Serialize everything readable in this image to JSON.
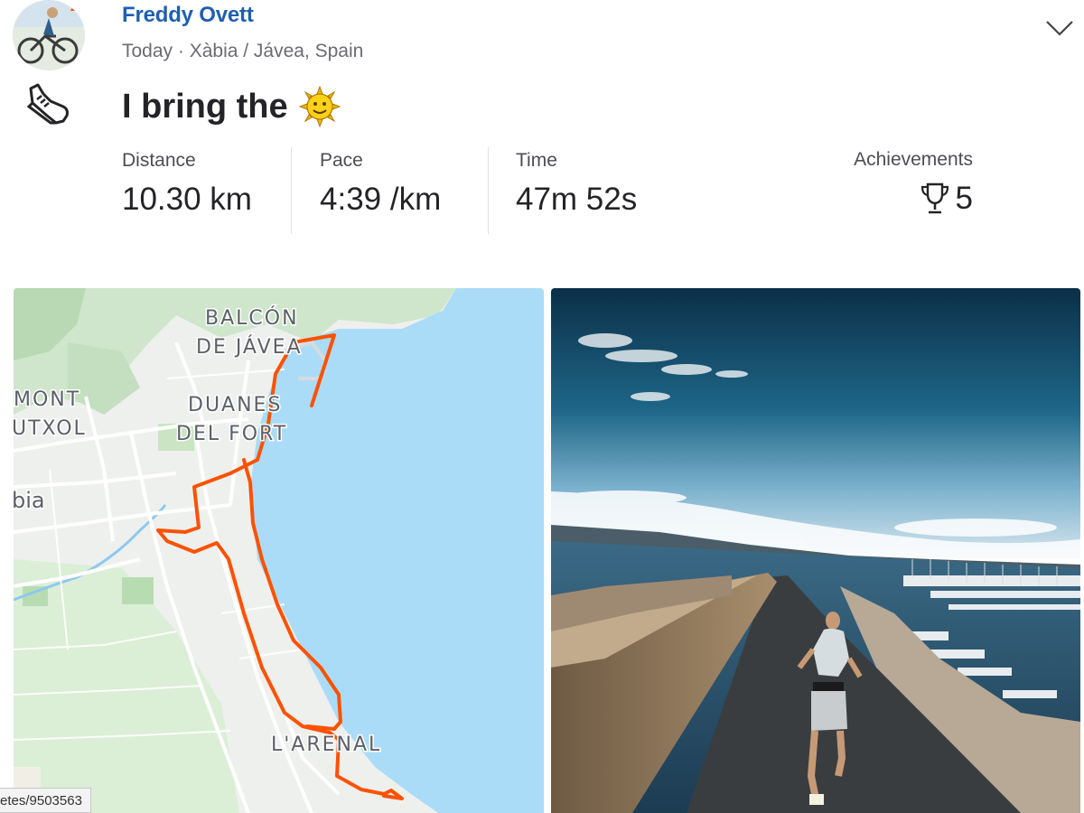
{
  "athlete": {
    "name": "Freddy Ovett"
  },
  "activity": {
    "meta": "Today · Xàbia / Jávea, Spain",
    "title": "I bring the",
    "title_emoji_icon": "sun-face-icon",
    "sport_icon": "running-shoe-icon",
    "brand_color": "#fc4c02"
  },
  "stats": {
    "distance": {
      "label": "Distance",
      "value": "10.30 km"
    },
    "pace": {
      "label": "Pace",
      "value": "4:39 /km"
    },
    "time": {
      "label": "Time",
      "value": "47m 52s"
    },
    "achievements": {
      "label": "Achievements",
      "value": "5",
      "icon": "trophy-icon"
    }
  },
  "map": {
    "labels": {
      "balcon": "BALCÓN",
      "de_javea": "DE JÁVEA",
      "mont": "MONT",
      "utxol": "UTXOL",
      "duanes": "DUANES",
      "del_fort": "DEL FORT",
      "bia": "bia",
      "arenal": "L'ARENAL"
    },
    "route_color": "#fc5200",
    "sea_color": "#aadcf7"
  },
  "status_bar": {
    "url_fragment": "etes/9503563"
  }
}
